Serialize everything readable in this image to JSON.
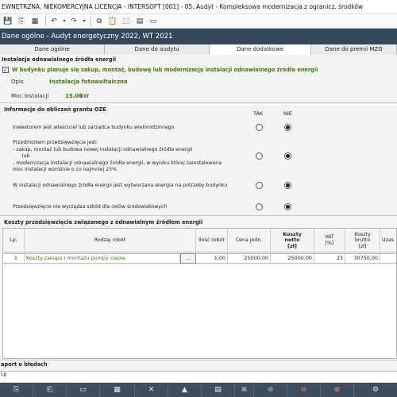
{
  "window": {
    "title": "EWNĘTRZNA, NIEKOMERCYJNA LICENCJA - INTERSOFT [001] - 05. Audyt - Kompleksowa modernizacja z ogranicz. środków"
  },
  "header": {
    "title": "Dane ogólne - Audyt energetyczny 2022, WT 2021"
  },
  "tabs": [
    {
      "label": "Dane ogólne"
    },
    {
      "label": "Dane do audytu"
    },
    {
      "label": "Dane dodatkowe"
    },
    {
      "label": "Dane do premii MZG"
    }
  ],
  "renewable": {
    "section_title": "Instalacja odnawialnego źródła energii",
    "checkbox_label": "W budynku planuje się zakup, montaż, budowę lub modernizację instalacji odnawialnego źródła energii",
    "checkbox_checked": true,
    "opis_label": "Opis",
    "opis_value": "Instalacja fotowoltaiczna",
    "moc_label": "Moc instalacji",
    "moc_value": "15,00",
    "moc_unit": "kW"
  },
  "grant": {
    "section_title": "Informacje do obliczeń grantu OZE",
    "col_yes": "TAK",
    "col_no": "NIE",
    "questions": [
      {
        "text": [
          "Inwestorem jest właściciel lub zarządca budynku wielorodzinnego"
        ],
        "answer": "NIE"
      },
      {
        "text": [
          "Przedmiotem przedsięwzięcia jest:",
          "- zakup, montaż lub budowa nowej instalacji odnawialnego źródła energii",
          "      lub",
          "- modernizacja instalacji odnawialnego źródła energii, w wyniku której zainstalowana",
          "moc instalacji wzrośnie o co najmniej 25%"
        ],
        "answer": "NIE"
      },
      {
        "text": [
          "W instalacji odnawialnego źródła energii jest wytwarzana energia na potrzeby budynku"
        ],
        "answer": "NIE"
      },
      {
        "text": [
          "Przedsięwzięcie nie wyrządza szkód dla celów środowiskowych"
        ],
        "answer": "NIE"
      }
    ]
  },
  "costs": {
    "section_title": "Koszty przedsięwzięcia związanego z odnawialnym źródłem energii",
    "columns": {
      "lp": "Lp.",
      "rodzaj": "Rodzaj robót",
      "ilosc": "Ilość robót",
      "cena": "Cena jedn.",
      "netto": [
        "Koszty",
        "netto",
        "[zł]"
      ],
      "vat": [
        "VAT",
        "[%]"
      ],
      "brutto": [
        "Koszty",
        "brutto",
        "[zł]"
      ],
      "uzas": "Uzas"
    },
    "rows": [
      {
        "lp": "1",
        "rodzaj": "Koszty zakupu i montażu pompy ciepła",
        "dots": "...",
        "ilosc": "1,00",
        "cena": "25000,00",
        "netto": "25000,00",
        "vat": "23",
        "brutto": "30750,00"
      }
    ]
  },
  "errors": {
    "section_title": "aport o błędach",
    "lp_label": "Lp"
  }
}
